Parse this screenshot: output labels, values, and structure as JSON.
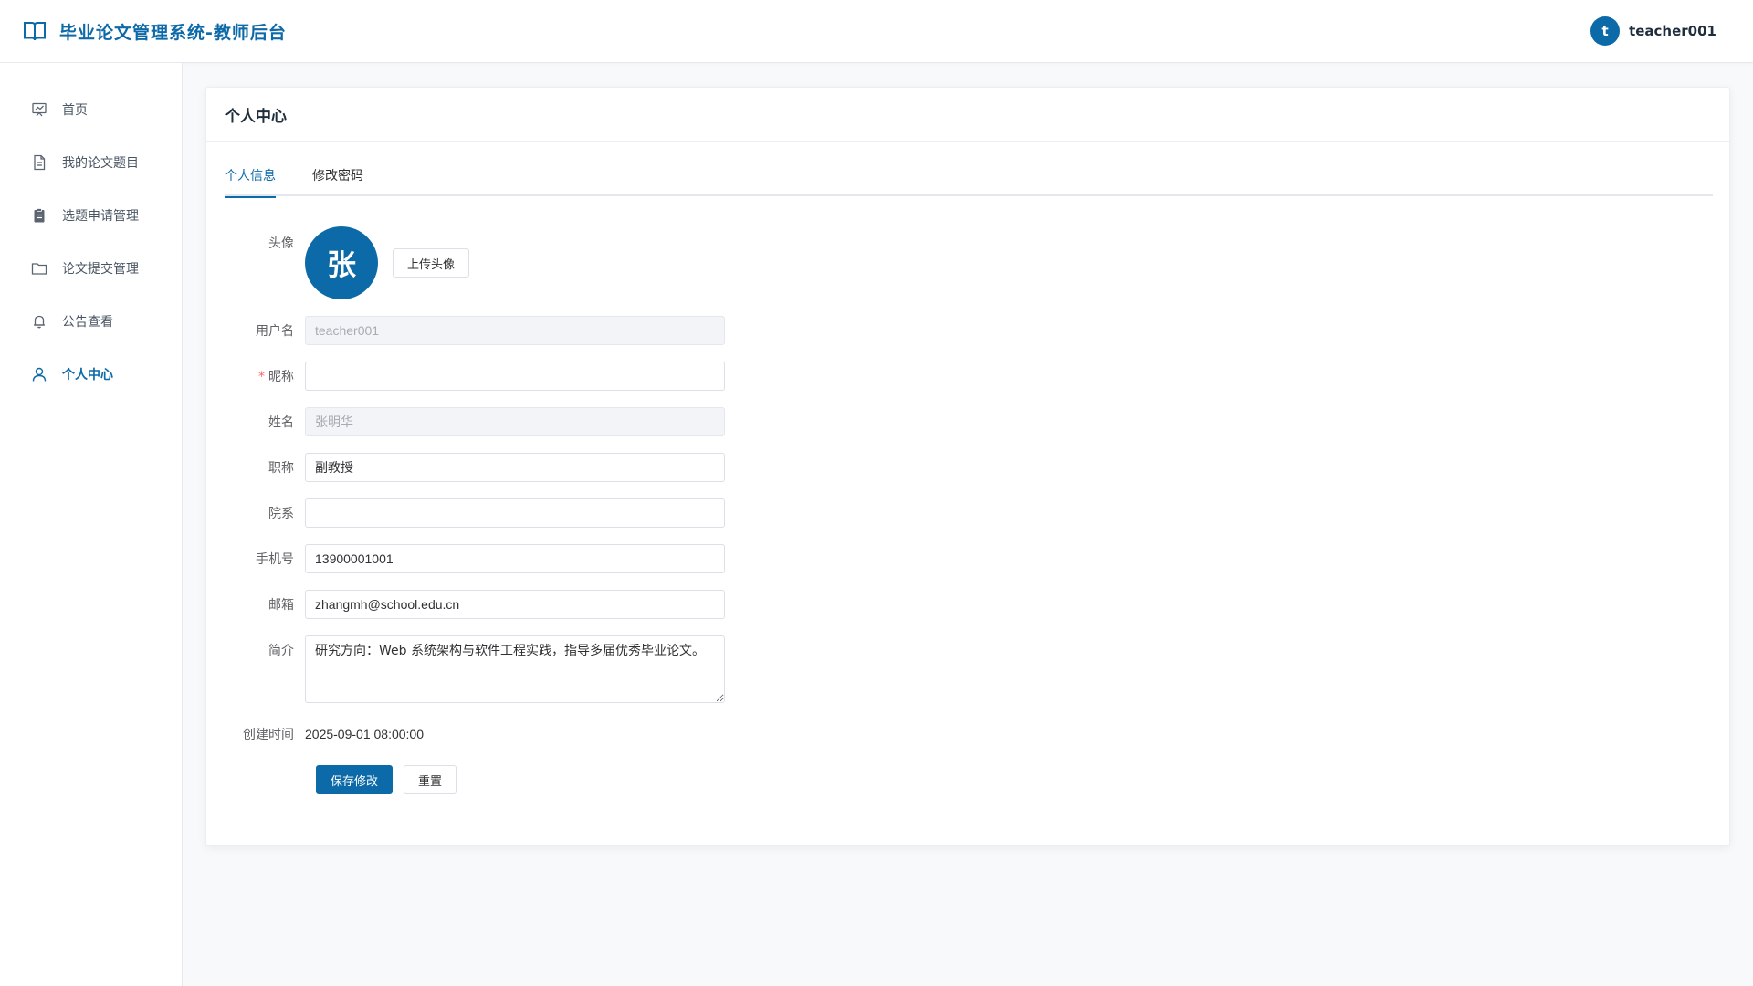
{
  "app": {
    "title": "毕业论文管理系统-教师后台"
  },
  "user": {
    "initial": "t",
    "name": "teacher001"
  },
  "sidebar": {
    "items": [
      {
        "label": "首页",
        "icon": "chart-board-icon",
        "active": false
      },
      {
        "label": "我的论文题目",
        "icon": "document-icon",
        "active": false
      },
      {
        "label": "选题申请管理",
        "icon": "clipboard-icon",
        "active": false
      },
      {
        "label": "论文提交管理",
        "icon": "folder-icon",
        "active": false
      },
      {
        "label": "公告查看",
        "icon": "bell-icon",
        "active": false
      },
      {
        "label": "个人中心",
        "icon": "user-icon",
        "active": true
      }
    ]
  },
  "card": {
    "title": "个人中心"
  },
  "tabs": [
    {
      "label": "个人信息",
      "active": true
    },
    {
      "label": "修改密码",
      "active": false
    }
  ],
  "form": {
    "avatar": {
      "label": "头像",
      "char": "张",
      "upload_label": "上传头像"
    },
    "username": {
      "label": "用户名",
      "value": "teacher001"
    },
    "nickname": {
      "label": "昵称",
      "value": "",
      "required_mark": "*"
    },
    "realname": {
      "label": "姓名",
      "value": "张明华"
    },
    "title": {
      "label": "职称",
      "value": "副教授"
    },
    "department": {
      "label": "院系",
      "value": ""
    },
    "phone": {
      "label": "手机号",
      "value": "13900001001"
    },
    "email": {
      "label": "邮箱",
      "value": "zhangmh@school.edu.cn"
    },
    "bio": {
      "label": "简介",
      "value": "研究方向：Web 系统架构与软件工程实践，指导多届优秀毕业论文。"
    },
    "created": {
      "label": "创建时间",
      "value": "2025-09-01 08:00:00"
    },
    "save_label": "保存修改",
    "reset_label": "重置"
  },
  "colors": {
    "primary": "#0d6aa8",
    "required": "#f56c6c"
  }
}
